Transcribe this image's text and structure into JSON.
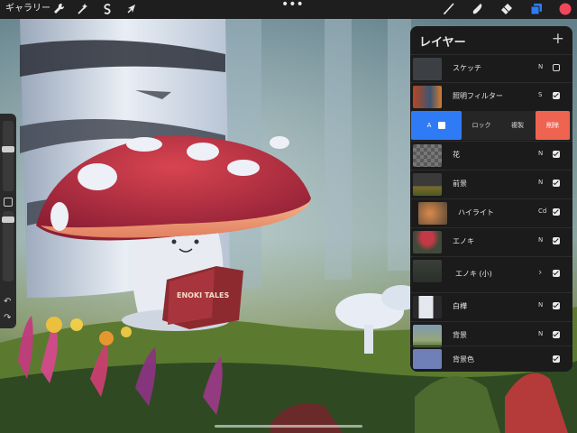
{
  "toolbar": {
    "gallery_label": "ギャラリー",
    "actions_icon": "wrench-icon",
    "adjust_icon": "magic-wand-icon",
    "select_icon": "s-select-icon",
    "transform_icon": "arrow-cursor-icon",
    "more_label": "•••",
    "brush_icon": "brush-icon",
    "smudge_icon": "smudge-icon",
    "eraser_icon": "eraser-icon",
    "layers_icon": "layers-icon",
    "color_swatch": "#f0475a"
  },
  "colors": {
    "accent_blue": "#2f7bf5",
    "delete_red": "#ef6451",
    "panel_bg": "#1b1b1c"
  },
  "layers_panel": {
    "title": "レイヤー",
    "add_label": "+",
    "options": {
      "layer_letter": "A",
      "lock": "ロック",
      "duplicate": "複製",
      "delete": "削除"
    },
    "layers": [
      {
        "name": "スケッチ",
        "mode": "N",
        "visible": false
      },
      {
        "name": "照明フィルター",
        "mode": "S",
        "visible": true
      },
      {
        "name": "花",
        "mode": "N",
        "visible": true
      },
      {
        "name": "前景",
        "mode": "N",
        "visible": true
      },
      {
        "name": "ハイライト",
        "mode": "Cd",
        "visible": true
      },
      {
        "name": "エノキ",
        "mode": "N",
        "visible": true
      },
      {
        "name": "エノキ (小)",
        "mode": "›",
        "visible": true
      },
      {
        "name": "白樺",
        "mode": "N",
        "visible": true
      },
      {
        "name": "背景",
        "mode": "N",
        "visible": true
      },
      {
        "name": "背景色",
        "mode": "",
        "visible": true
      }
    ]
  },
  "canvas": {
    "book_title": "ENOKI TALES"
  }
}
